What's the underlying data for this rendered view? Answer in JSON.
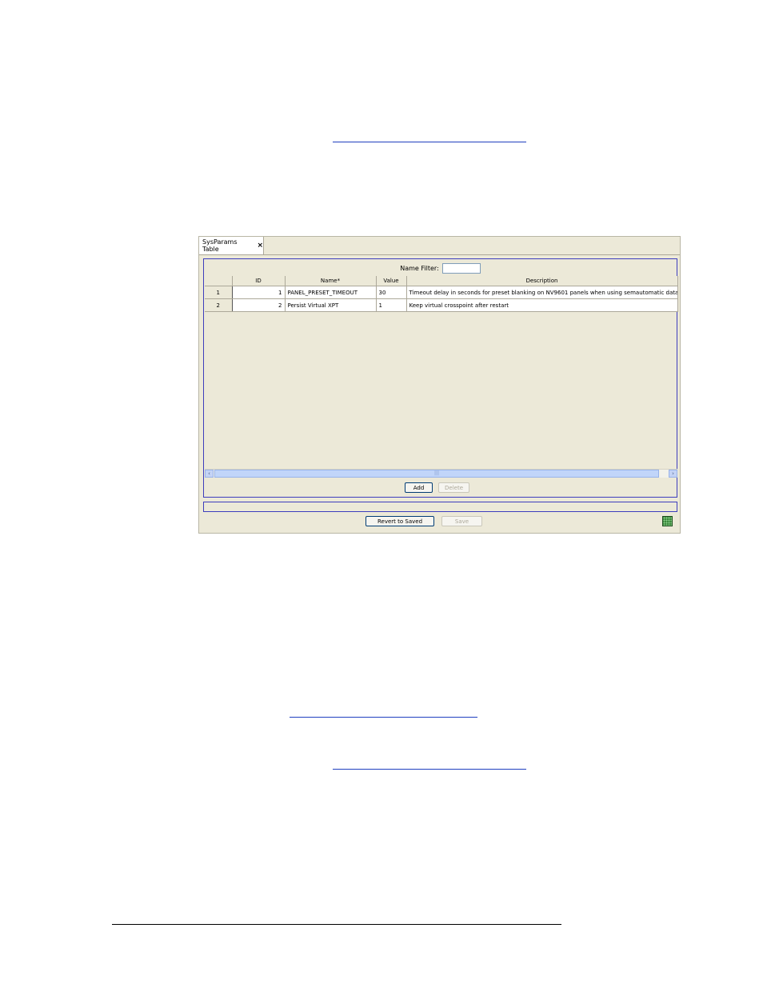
{
  "window": {
    "tab_label": "SysParams Table",
    "tab_close_glyph": "×"
  },
  "filter": {
    "label": "Name Filter:",
    "value": ""
  },
  "table": {
    "columns": [
      "ID",
      "Name*",
      "Value",
      "Description"
    ],
    "rows": [
      {
        "row_num": "1",
        "id": "1",
        "name": "PANEL_PRESET_TIMEOUT",
        "value": "30",
        "description": "Timeout delay in seconds for preset blanking on NV9601 panels when using semautomatic data rou"
      },
      {
        "row_num": "2",
        "id": "2",
        "name": "Persist Virtual XPT",
        "value": "1",
        "description": "Keep virtual crosspoint after restart"
      }
    ]
  },
  "scrollbar": {
    "left_glyph": "‹",
    "right_glyph": "›",
    "grip_glyph": "|||"
  },
  "buttons": {
    "add": "Add",
    "delete": "Delete",
    "revert": "Revert to Saved",
    "save": "Save"
  },
  "icons": {
    "status": "status-grid-icon"
  }
}
